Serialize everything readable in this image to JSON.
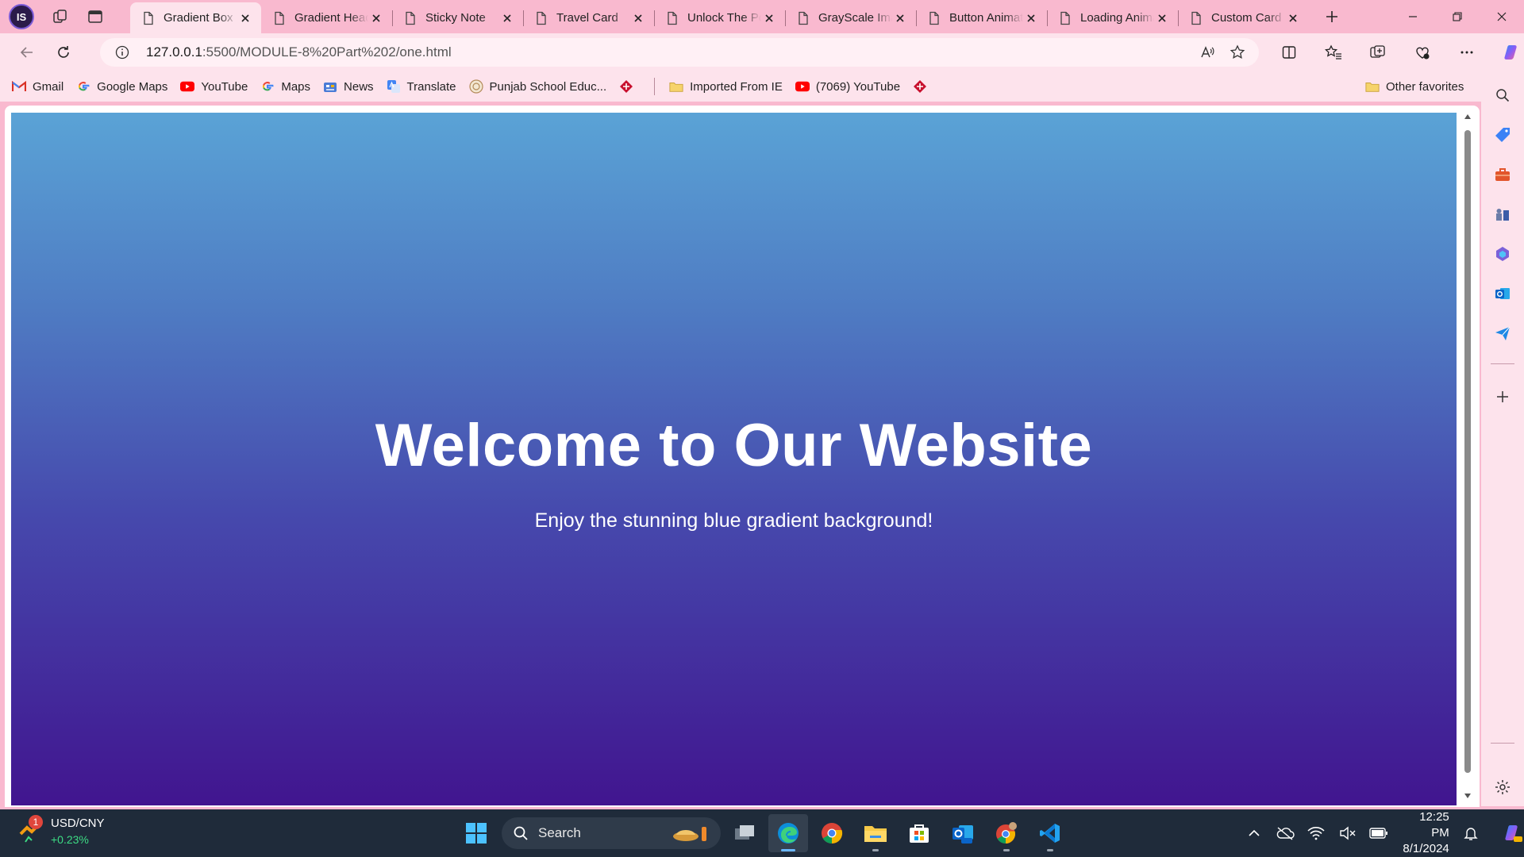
{
  "browser": {
    "profile_initials": "IS",
    "tabs": [
      {
        "title": "Gradient Box",
        "active": true
      },
      {
        "title": "Gradient Header",
        "active": false
      },
      {
        "title": "Sticky Note",
        "active": false
      },
      {
        "title": "Travel Card",
        "active": false
      },
      {
        "title": "Unlock The Power",
        "active": false
      },
      {
        "title": "GrayScale Image",
        "active": false
      },
      {
        "title": "Button Animation",
        "active": false
      },
      {
        "title": "Loading Animation",
        "active": false
      },
      {
        "title": "Custom Card",
        "active": false
      }
    ],
    "address": {
      "host": "127.0.0.1",
      "path": ":5500/MODULE-8%20Part%202/one.html"
    },
    "favorites": [
      {
        "label": "Gmail",
        "icon": "gmail-icon"
      },
      {
        "label": "Google Maps",
        "icon": "google-icon"
      },
      {
        "label": "YouTube",
        "icon": "youtube-icon"
      },
      {
        "label": "Maps",
        "icon": "google-icon"
      },
      {
        "label": "News",
        "icon": "news-icon"
      },
      {
        "label": "Translate",
        "icon": "translate-icon"
      },
      {
        "label": "Punjab School Educ...",
        "icon": "school-icon"
      }
    ],
    "favorites_after": [
      {
        "label": "Imported From IE",
        "icon": "folder-icon"
      },
      {
        "label": "(7069) YouTube",
        "icon": "youtube-icon"
      }
    ],
    "other_favorites": "Other favorites"
  },
  "page": {
    "title": "Welcome to Our Website",
    "subtitle": "Enjoy the stunning blue gradient background!",
    "gradient_colors": [
      "#5aa3d6",
      "#4f7cc3",
      "#4649ad",
      "#41158f"
    ]
  },
  "taskbar": {
    "widget": {
      "title": "USD/CNY",
      "change": "+0.23%",
      "badge": "1"
    },
    "search_label": "Search",
    "apps": [
      "task-view",
      "edge",
      "chrome",
      "file-explorer",
      "microsoft-store",
      "outlook-new",
      "chrome-profile",
      "vscode"
    ],
    "time": "12:25 PM",
    "date": "8/1/2024"
  }
}
